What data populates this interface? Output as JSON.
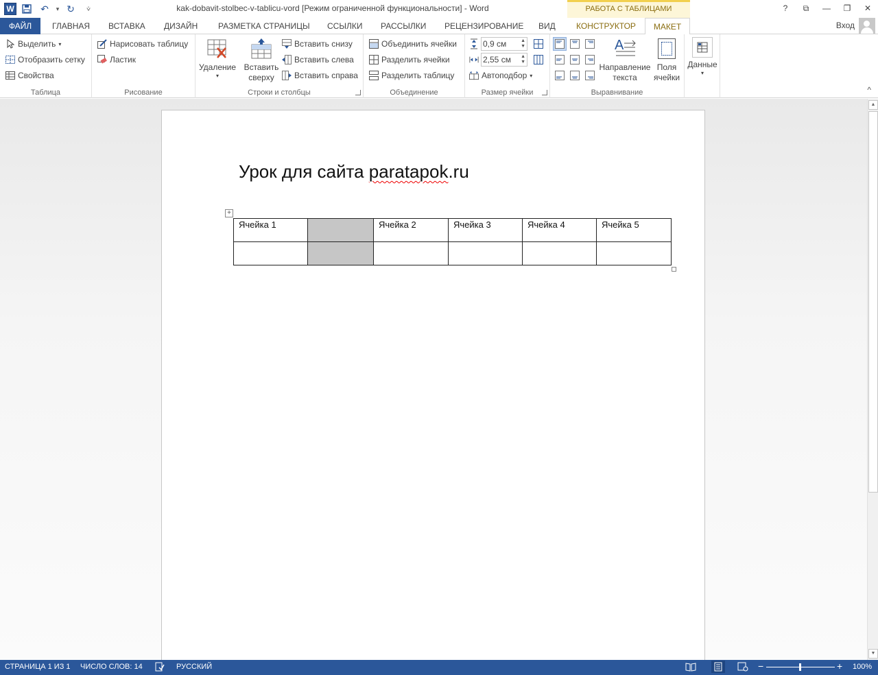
{
  "window": {
    "title": "kak-dobavit-stolbec-v-tablicu-vord [Режим ограниченной функциональности] - Word",
    "context_tab_group": "РАБОТА С ТАБЛИЦАМИ",
    "controls": {
      "help": "?",
      "restore_ribbon": "⧉",
      "minimize": "—",
      "maximize": "❐",
      "close": "✕"
    }
  },
  "quick_access": {
    "logo": "W",
    "save_icon": "💾",
    "undo_icon": "↶",
    "undo_dropdown": "▾",
    "redo_icon": "↻",
    "customize": "⩒"
  },
  "tabs": [
    {
      "label": "ФАЙЛ"
    },
    {
      "label": "ГЛАВНАЯ"
    },
    {
      "label": "ВСТАВКА"
    },
    {
      "label": "ДИЗАЙН"
    },
    {
      "label": "РАЗМЕТКА СТРАНИЦЫ"
    },
    {
      "label": "ССЫЛКИ"
    },
    {
      "label": "РАССЫЛКИ"
    },
    {
      "label": "РЕЦЕНЗИРОВАНИЕ"
    },
    {
      "label": "ВИД"
    },
    {
      "label": "КОНСТРУКТОР"
    },
    {
      "label": "МАКЕТ"
    }
  ],
  "account": {
    "sign_in": "Вход"
  },
  "ribbon": {
    "table_group": {
      "label": "Таблица",
      "select": "Выделить",
      "show_grid": "Отобразить сетку",
      "properties": "Свойства"
    },
    "draw_group": {
      "label": "Рисование",
      "draw_table": "Нарисовать таблицу",
      "eraser": "Ластик"
    },
    "rows_cols_group": {
      "label": "Строки и столбцы",
      "delete": "Удаление",
      "insert_above_1": "Вставить",
      "insert_above_2": "сверху",
      "insert_below": "Вставить снизу",
      "insert_left": "Вставить слева",
      "insert_right": "Вставить справа"
    },
    "merge_group": {
      "label": "Объединение",
      "merge_cells": "Объединить ячейки",
      "split_cells": "Разделить ячейки",
      "split_table": "Разделить таблицу"
    },
    "cell_size_group": {
      "label": "Размер ячейки",
      "height_value": "0,9 см",
      "width_value": "2,55 см",
      "autofit": "Автоподбор"
    },
    "alignment_group": {
      "label": "Выравнивание",
      "text_direction_1": "Направление",
      "text_direction_2": "текста",
      "cell_margins_1": "Поля",
      "cell_margins_2": "ячейки"
    },
    "data_group": {
      "data": "Данные"
    }
  },
  "document": {
    "heading_plain": "Урок для сайта ",
    "heading_misspelled": "paratapok",
    "heading_suffix": ".ru",
    "table": {
      "rows": [
        [
          "Ячейка 1",
          "",
          "Ячейка 2",
          "Ячейка 3",
          "Ячейка 4",
          "Ячейка 5"
        ],
        [
          "",
          "",
          "",
          "",
          "",
          ""
        ]
      ],
      "selected_column_index": 1
    }
  },
  "status": {
    "page": "СТРАНИЦА 1 ИЗ 1",
    "words": "ЧИСЛО СЛОВ: 14",
    "language": "РУССКИЙ",
    "zoom_minus": "−",
    "zoom_plus": "+",
    "zoom": "100%"
  },
  "colors": {
    "accent": "#2b579a",
    "context_tab": "#8a6d10",
    "selection": "#c6c6c6"
  }
}
